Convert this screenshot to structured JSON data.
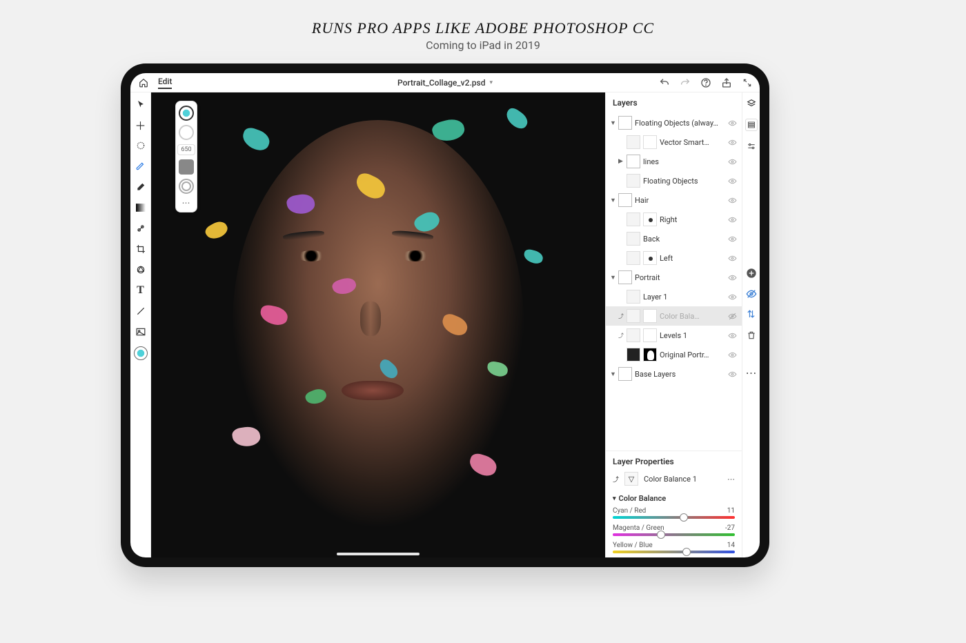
{
  "marketing": {
    "headline": "Runs pro apps like Adobe Photoshop CC",
    "subheadline": "Coming to iPad in 2019"
  },
  "topbar": {
    "menu_edit": "Edit",
    "document_name": "Portrait_Collage_v2.psd"
  },
  "tool_options": {
    "brush_size": "650"
  },
  "layers_panel": {
    "title": "Layers",
    "groups": [
      {
        "label": "Floating Objects (alway…",
        "folder": true,
        "expanded": true,
        "children": [
          {
            "label": "Vector Smart…",
            "mask": true
          },
          {
            "label": "lines",
            "folder": true,
            "arrow": true
          },
          {
            "label": "Floating Objects"
          }
        ]
      },
      {
        "label": "Hair",
        "folder": true,
        "expanded": true,
        "children": [
          {
            "label": "Right",
            "maskdot": true
          },
          {
            "label": "Back"
          },
          {
            "label": "Left",
            "maskdot": true
          }
        ]
      },
      {
        "label": "Portrait",
        "folder": true,
        "expanded": true,
        "children": [
          {
            "label": "Layer 1"
          },
          {
            "label": "Color Bala…",
            "adj": true,
            "selected": true,
            "dim": true
          },
          {
            "label": "Levels 1",
            "adj": true
          },
          {
            "label": "Original Portr…",
            "masksil": true,
            "dark": true
          }
        ]
      },
      {
        "label": "Base Layers",
        "folder": true,
        "expanded": true
      }
    ]
  },
  "layer_properties": {
    "title": "Layer Properties",
    "current_name": "Color Balance 1",
    "section": "Color Balance",
    "sliders": [
      {
        "label": "Cyan / Red",
        "value": 11,
        "pos": 55
      },
      {
        "label": "Magenta / Green",
        "value": -27,
        "pos": 36
      },
      {
        "label": "Yellow / Blue",
        "value": 14,
        "pos": 57
      }
    ]
  }
}
